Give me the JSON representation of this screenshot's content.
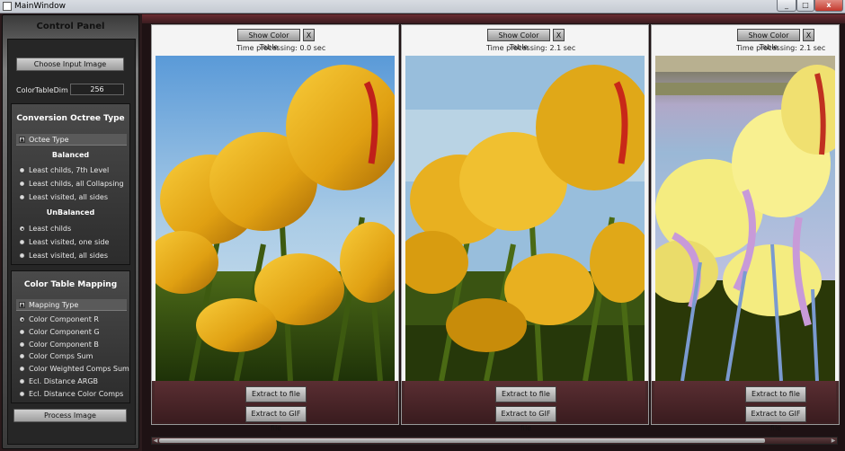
{
  "window": {
    "title": "MainWindow",
    "minimize": "_",
    "maximize": "□",
    "close": "x"
  },
  "control_panel": {
    "title": "Control Panel",
    "choose_input": "Choose Input Image",
    "color_table_dim_label": "ColorTableDim",
    "color_table_dim_value": "256",
    "octree": {
      "title": "Conversion Octree Type",
      "expander": "Octee Type",
      "balanced_head": "Balanced",
      "balanced_options": [
        "Least childs, 7th Level",
        "Least childs, all Collapsing",
        "Least visited, all sides"
      ],
      "unbalanced_head": "UnBalanced",
      "unbalanced_options": [
        "Least childs",
        "Least visited, one side",
        "Least visited, all sides"
      ],
      "selected": "Least childs"
    },
    "mapping": {
      "title": "Color Table Mapping",
      "expander": "Mapping Type",
      "options": [
        "Color Component R",
        "Color Component G",
        "Color Component B",
        "Color Comps Sum",
        "Color Weighted Comps Sum",
        "Ecl. Distance ARGB",
        "Ecl. Distance Color Comps"
      ],
      "selected": "Color Component R"
    },
    "process": "Process Image"
  },
  "panels": [
    {
      "show_color_table": "Show Color Table",
      "close": "X",
      "time": "Time processing: 0.0 sec",
      "extract_file": "Extract to file",
      "extract_gif": "Extract to GIF file"
    },
    {
      "show_color_table": "Show Color Table",
      "close": "X",
      "time": "Time processing: 2.1 sec",
      "extract_file": "Extract to file",
      "extract_gif": "Extract to GIF file"
    },
    {
      "show_color_table": "Show Color Table",
      "close": "X",
      "time": "Time processing: 2.1 sec",
      "extract_file": "Extract to file",
      "extract_gif": "Extract to GIF file"
    }
  ],
  "scrollbar": {
    "left_arrow": "◀",
    "right_arrow": "▶"
  }
}
